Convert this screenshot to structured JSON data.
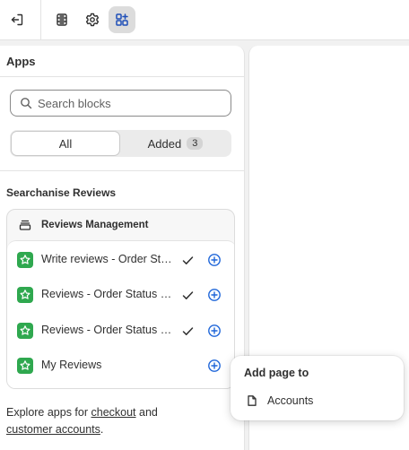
{
  "toolbar": {
    "exit_icon": "exit-icon",
    "sections_icon": "sections-icon",
    "settings_icon": "gear-icon",
    "apps_icon": "apps-icon",
    "active_color": "#dcdcdc"
  },
  "panel": {
    "title": "Apps",
    "search": {
      "placeholder": "Search blocks",
      "value": ""
    },
    "filter": {
      "options": [
        "All",
        "Added"
      ],
      "selected": "All",
      "added_count": "3"
    },
    "section_title": "Searchanise Reviews",
    "group": {
      "title": "Reviews Management",
      "items": [
        {
          "label": "Write reviews - Order Status",
          "added": true
        },
        {
          "label": "Reviews - Order Status page",
          "added": true
        },
        {
          "label": "Reviews - Order Status page",
          "added": true
        },
        {
          "label": "My Reviews",
          "added": false
        }
      ]
    },
    "explore": {
      "prefix": "Explore apps for ",
      "link1": "checkout",
      "middle": " and",
      "link2": "customer accounts",
      "suffix": "."
    }
  },
  "popover": {
    "title": "Add page to",
    "items": [
      {
        "label": "Accounts"
      }
    ]
  },
  "colors": {
    "app_icon_bg": "#2fa84f",
    "add_icon": "#1f66d9",
    "background": "#f1f1f1"
  }
}
